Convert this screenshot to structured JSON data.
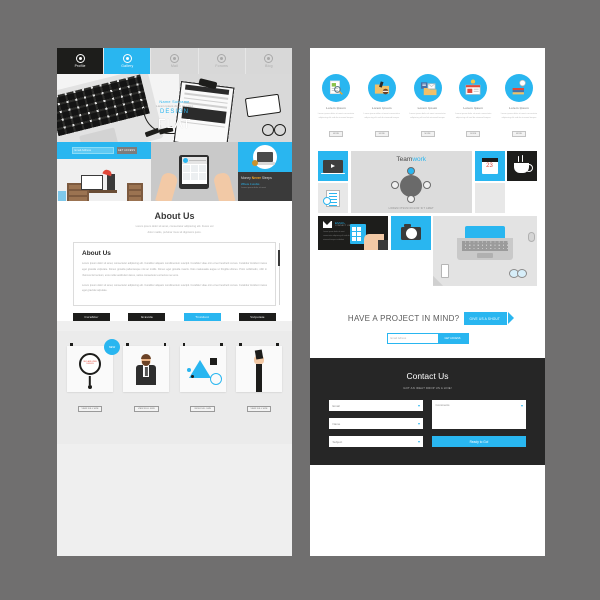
{
  "meta": {
    "background_color": "#706f6f",
    "accent_color": "#29b6f0",
    "dark_color": "#1d1d1b"
  },
  "left_page": {
    "nav": {
      "tabs": [
        {
          "label": "Profile",
          "state": "dark",
          "icon": "user-icon"
        },
        {
          "label": "Gallery",
          "state": "active",
          "icon": "image-icon"
        },
        {
          "label": "Mail",
          "state": "default",
          "icon": "mail-icon"
        },
        {
          "label": "Forums",
          "state": "default",
          "icon": "chat-icon"
        },
        {
          "label": "Blog",
          "state": "default",
          "icon": "pencil-icon"
        }
      ]
    },
    "hero": {
      "name": "Name Surname",
      "tagline": "Lorem ipsum dolor sit amet",
      "accent_word": "DESIGN",
      "headline": "FLAT"
    },
    "trio": {
      "signup": {
        "placeholder": "Email Address",
        "button": "GET ACCESS"
      },
      "promo": {
        "title_1": "Money",
        "title_accent": "Never",
        "title_2": "Sleeps",
        "subtitle": "Where it works",
        "caption": "Lorem ipsum dolor sit amet"
      }
    },
    "about": {
      "heading": "About Us",
      "subtitle_line1": "Lorem ipsum dolor sit amet, consectetur adipiscing elit. Fusce vel",
      "subtitle_line2": "dolor mattis, pulvinar risus sit dignissim justo.",
      "box_heading": "About Us",
      "paragraph_1": "Lorem ipsum dolor sit amet, consectetur adipiscing elit. Curabitur aliquam condimentum suscipit. Curabitur vitae orci et leo hendrerit cursus. Curabitur tincidunt metus eget gravida vulputate. Donec gravida pellentesque nisi ac mollis. Donec eget gravida mauris. Duis malesuada augue ut fringilla ultrices. Proin sollicitudin, nibh in rhoncus fermentum, eros nulla vestibulum lacus, varius consectetur est lectus nec eros.",
      "paragraph_2": "Lorem ipsum dolor sit amet, consectetur adipiscing elit. Curabitur aliquam condimentum suscipit. Curabitur vitae orci et leo hendrerit cursus. Curabitur tincidunt metus eget gravida vulputate.",
      "buttons": [
        {
          "label": "Curabitur",
          "state": "default"
        },
        {
          "label": "Gravida",
          "state": "default"
        },
        {
          "label": "Tincidunt",
          "state": "active"
        },
        {
          "label": "Vulputate",
          "state": "default"
        }
      ]
    },
    "cards": {
      "badge": "NEW",
      "magnifier_text": "SEO AND WEB DESIGN",
      "items": [
        {
          "caption": "VIEW FULL SIZE",
          "icon": "magnifier-icon"
        },
        {
          "caption": "VIEW FULL SIZE",
          "icon": "businessman-icon"
        },
        {
          "caption": "VIEW FULL SIZE",
          "icon": "abstract-triangle-icon"
        },
        {
          "caption": "VIEW FULL SIZE",
          "icon": "hand-brush-icon"
        }
      ]
    }
  },
  "right_page": {
    "services": [
      {
        "title": "Lorem Ipsum",
        "desc": "Lorem ipsum dolor sit amet consectetur adipiscing elit sed do eiusmod tempor",
        "button": "MORE",
        "icon": "document-search-icon"
      },
      {
        "title": "Lorem Ipsum",
        "desc": "Lorem ipsum dolor sit amet consectetur adipiscing elit sed do eiusmod tempor",
        "button": "MORE",
        "icon": "folder-coffee-icon"
      },
      {
        "title": "Lorem Ipsum",
        "desc": "Lorem ipsum dolor sit amet consectetur adipiscing elit sed do eiusmod tempor",
        "button": "MORE",
        "icon": "mail-folder-icon"
      },
      {
        "title": "Lorem Ipsum",
        "desc": "Lorem ipsum dolor sit amet consectetur adipiscing elit sed do eiusmod tempor",
        "button": "MORE",
        "icon": "browser-idea-icon"
      },
      {
        "title": "Lorem Ipsum",
        "desc": "Lorem ipsum dolor sit amet consectetur adipiscing elit sed do eiusmod tempor",
        "button": "MORE",
        "icon": "books-bulb-icon"
      }
    ],
    "tiles": {
      "team_title_1": "Team",
      "team_title_2": "work",
      "team_caption": "LOREM IPSUM DOLOR SIT AMET",
      "calendar_day": "23",
      "email": {
        "title": "EMAIL",
        "subtitle": "CONTACT US",
        "desc": "Lorem ipsum dolor sit amet consectetur adipiscing elit sed do eiusmod tempor incididunt"
      }
    },
    "cta": {
      "heading": "HAVE A PROJECT IN MIND?",
      "button": "GIVE US A SHOUT",
      "input_placeholder": "Email Adress",
      "submit": "GET ACCESS"
    },
    "contact": {
      "heading": "Contact Us",
      "subtitle": "GOT AN IDEA? DROP US A LINE!",
      "fields": [
        {
          "label": "Email"
        },
        {
          "label": "Name"
        },
        {
          "label": "Subject"
        }
      ],
      "comments_label": "Comments",
      "submit": "Ready to Go!"
    }
  }
}
